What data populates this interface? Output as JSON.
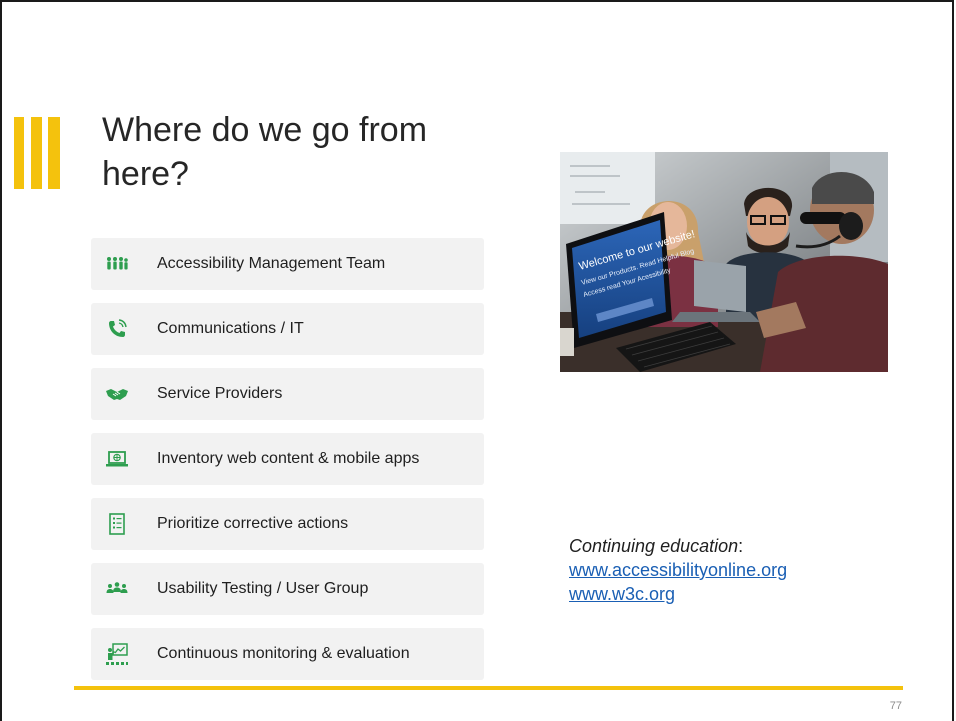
{
  "slide": {
    "title": "Where do we go from here?",
    "page_number": "77",
    "accent_color": "#f4c20d",
    "icon_color": "#2e9e4f"
  },
  "items": [
    {
      "label": "Accessibility Management Team",
      "icon": "team-icon"
    },
    {
      "label": "Communications / IT",
      "icon": "phone-icon"
    },
    {
      "label": "Service Providers",
      "icon": "handshake-icon"
    },
    {
      "label": "Inventory web content & mobile apps",
      "icon": "laptop-globe-icon"
    },
    {
      "label": "Prioritize corrective actions",
      "icon": "checklist-icon"
    },
    {
      "label": "Usability Testing / User Group",
      "icon": "user-group-icon"
    },
    {
      "label": "Continuous monitoring & evaluation",
      "icon": "presenter-icon"
    }
  ],
  "photo": {
    "screen_text": {
      "line1": "Welcome to our website!",
      "line2": "View our Products. Read Helpful Blog",
      "line3": "Access read Your Acessibility"
    }
  },
  "education": {
    "lead": "Continuing education",
    "suffix": ":",
    "links": [
      "www.accessibilityonline.org",
      "www.w3c.org"
    ]
  }
}
